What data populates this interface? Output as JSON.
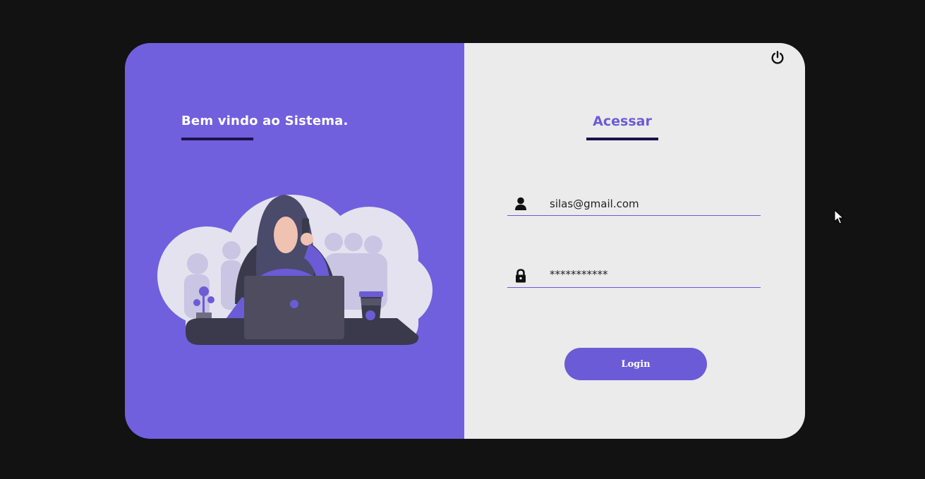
{
  "welcome": {
    "title": "Bem vindo ao Sistema."
  },
  "login": {
    "title": "Acessar",
    "email_value": "silas@gmail.com",
    "password_value": "***********",
    "button_label": "Login"
  },
  "colors": {
    "accent": "#6b5bd6",
    "left_panel": "#7060de",
    "right_panel": "#ebebeb",
    "underline": "#1a1347",
    "background": "#121212"
  },
  "icons": {
    "power": "power-icon",
    "user": "user-icon",
    "lock": "lock-icon"
  }
}
